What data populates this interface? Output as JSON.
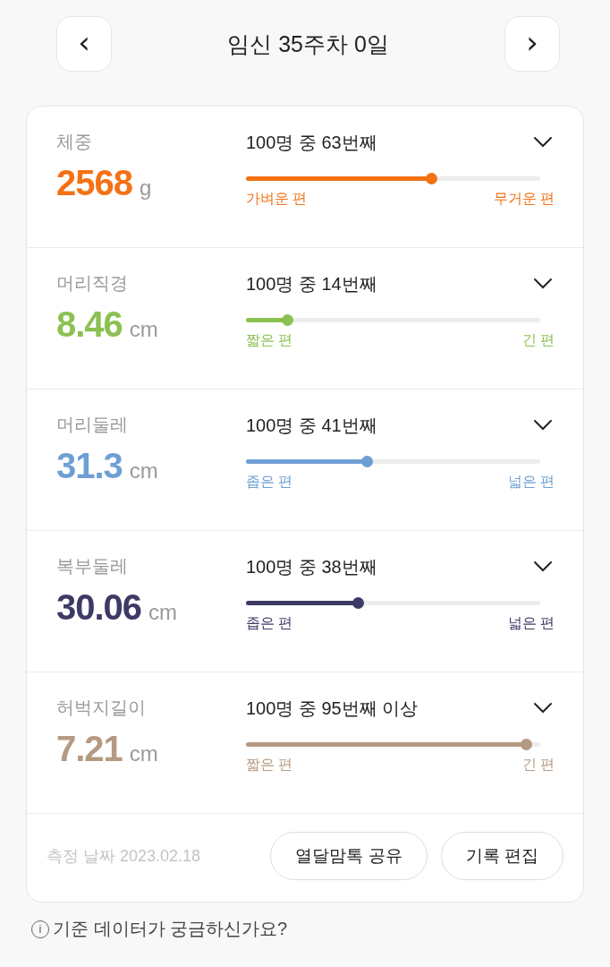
{
  "header": {
    "title": "임신 35주차 0일",
    "prev": "‹",
    "next": "›"
  },
  "measures": [
    {
      "name": "체중",
      "value": "2568",
      "unit": "g",
      "color": "#f47114",
      "rank": "100명 중 63번째",
      "level": 0.63,
      "low_label": "가벼운 편",
      "high_label": "무거운 편"
    },
    {
      "name": "머리직경",
      "value": "8.46",
      "unit": "cm",
      "color": "#8cc152",
      "rank": "100명 중 14번째",
      "level": 0.14,
      "low_label": "짧은 편",
      "high_label": "긴 편"
    },
    {
      "name": "머리둘레",
      "value": "31.3",
      "unit": "cm",
      "color": "#6e9fd4",
      "rank": "100명 중 41번째",
      "level": 0.41,
      "low_label": "좁은 편",
      "high_label": "넓은 편"
    },
    {
      "name": "복부둘레",
      "value": "30.06",
      "unit": "cm",
      "color": "#3d3a66",
      "rank": "100명 중 38번째",
      "level": 0.38,
      "low_label": "좁은 편",
      "high_label": "넓은 편"
    },
    {
      "name": "허벅지길이",
      "value": "7.21",
      "unit": "cm",
      "color": "#b59a82",
      "rank": "100명 중 95번째 이상",
      "level": 0.95,
      "low_label": "짧은 편",
      "high_label": "긴 편"
    }
  ],
  "footer": {
    "date": "측정 날짜 2023.02.18",
    "buttons": [
      "열달맘톡 공유",
      "기록 편집"
    ]
  },
  "info": {
    "icon": "i",
    "text": "기준 데이터가 궁금하신가요?"
  }
}
